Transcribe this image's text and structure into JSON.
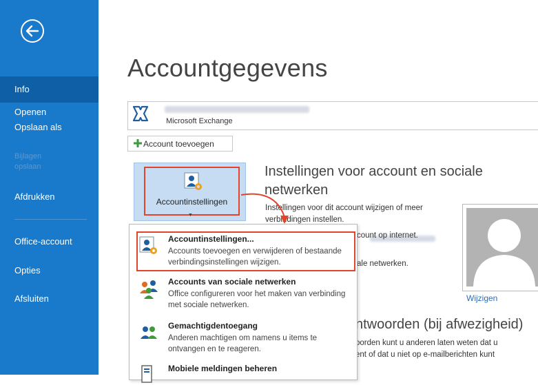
{
  "sidebar": {
    "items": [
      {
        "label": "Info"
      },
      {
        "label": "Openen"
      },
      {
        "label": "Opslaan als"
      },
      {
        "label": "Bijlagen opslaan"
      },
      {
        "label": "Afdrukken"
      },
      {
        "label": "Office-account"
      },
      {
        "label": "Opties"
      },
      {
        "label": "Afsluiten"
      }
    ]
  },
  "page": {
    "title": "Accountgegevens",
    "account_type": "Microsoft Exchange",
    "add_account": "Account toevoegen",
    "settings_button": "Accountinstellingen",
    "section_title": "Instellingen voor account en sociale netwerken",
    "section_desc": "Instellingen voor dit account wijzigen of meer verbindingen instellen.",
    "partial_1": "count op internet.",
    "partial_2": "ale netwerken.",
    "change_photo": "Wijzigen",
    "section2_title": "ntwoorden (bij afwezigheid)",
    "section2_line1": "oorden kunt u anderen laten weten dat u",
    "section2_line2": "ent of dat u niet op e-mailberichten kunt"
  },
  "menu": {
    "items": [
      {
        "title": "Accountinstellingen...",
        "desc": "Accounts toevoegen en verwijderen of bestaande verbindingsinstellingen wijzigen.",
        "icon": "account-settings-icon"
      },
      {
        "title": "Accounts van sociale netwerken",
        "desc": "Office configureren voor het maken van verbinding met sociale netwerken.",
        "icon": "social-network-icon"
      },
      {
        "title": "Gemachtigdentoegang",
        "desc": "Anderen machtigen om namens u items te ontvangen en te reageren.",
        "icon": "delegate-access-icon"
      },
      {
        "title": "Mobiele meldingen beheren",
        "desc": "",
        "icon": "mobile-alerts-icon"
      }
    ]
  },
  "colors": {
    "sidebar": "#1979ca",
    "sidebar_active": "#0f5fa6",
    "highlight": "#e2432a",
    "link": "#2a6ebb"
  }
}
